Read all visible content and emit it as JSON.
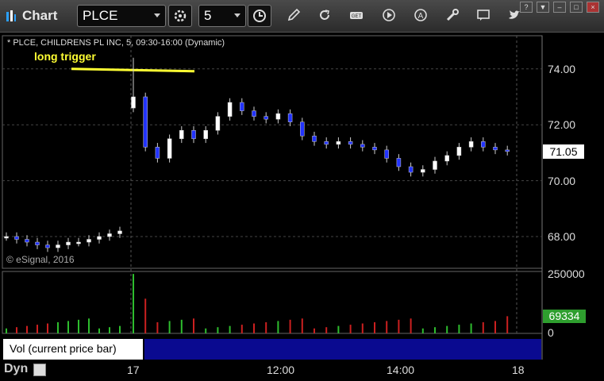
{
  "window": {
    "title": "Chart"
  },
  "toolbar": {
    "symbol": "PLCE",
    "interval": "5",
    "icons": [
      "symbol-dropdown-icon",
      "settings-gear-icon",
      "interval-dropdown-icon",
      "clock-icon",
      "draw-pencil-icon",
      "refresh-icon",
      "get-data-icon",
      "play-icon",
      "alert-icon",
      "tools-icon",
      "comment-icon",
      "twitter-icon"
    ],
    "window_controls": [
      "?",
      "▼",
      "–",
      "□",
      "×"
    ]
  },
  "chart": {
    "title": "* PLCE, CHILDRENS PL INC, 5, 09:30-16:00 (Dynamic)",
    "annotation": "long trigger",
    "copyright": "© eSignal, 2016",
    "last_price": "71.05",
    "y_ticks": [
      "74.00",
      "72.00",
      "70.00",
      "68.00"
    ],
    "volume_ticks": [
      "250000",
      "0"
    ],
    "volume_last": "69334",
    "volume_legend": "Vol (current price bar)",
    "volume_close": "×",
    "x_ticks": [
      "17",
      "12:00",
      "14:00",
      "18"
    ],
    "mode_label": "Dyn",
    "colors": {
      "up": "#ffffff",
      "down": "#2233ff",
      "vol_up": "#2ebd2e",
      "vol_down": "#cc2020",
      "trigger_line": "#ffff33"
    }
  },
  "chart_data": {
    "type": "candlestick",
    "symbol": "PLCE",
    "y_range": [
      67,
      75
    ],
    "trigger_price": 74.0,
    "last_price": 71.05,
    "prior_day_close_range": [
      67.5,
      68.3
    ],
    "opening_gap_high": 74.4,
    "intraday_low": 70.0,
    "closes_approx": [
      68.0,
      67.9,
      67.8,
      67.7,
      67.6,
      67.7,
      67.8,
      67.8,
      67.9,
      68.0,
      68.1,
      68.2,
      73.0,
      71.2,
      70.8,
      71.5,
      71.8,
      71.5,
      71.8,
      72.3,
      72.8,
      72.5,
      72.3,
      72.2,
      72.4,
      72.1,
      71.6,
      71.4,
      71.3,
      71.4,
      71.3,
      71.2,
      71.1,
      70.8,
      70.5,
      70.3,
      70.4,
      70.7,
      70.9,
      71.2,
      71.4,
      71.2,
      71.1,
      71.05
    ],
    "volume_range": [
      0,
      250000
    ],
    "last_volume": 69334
  }
}
